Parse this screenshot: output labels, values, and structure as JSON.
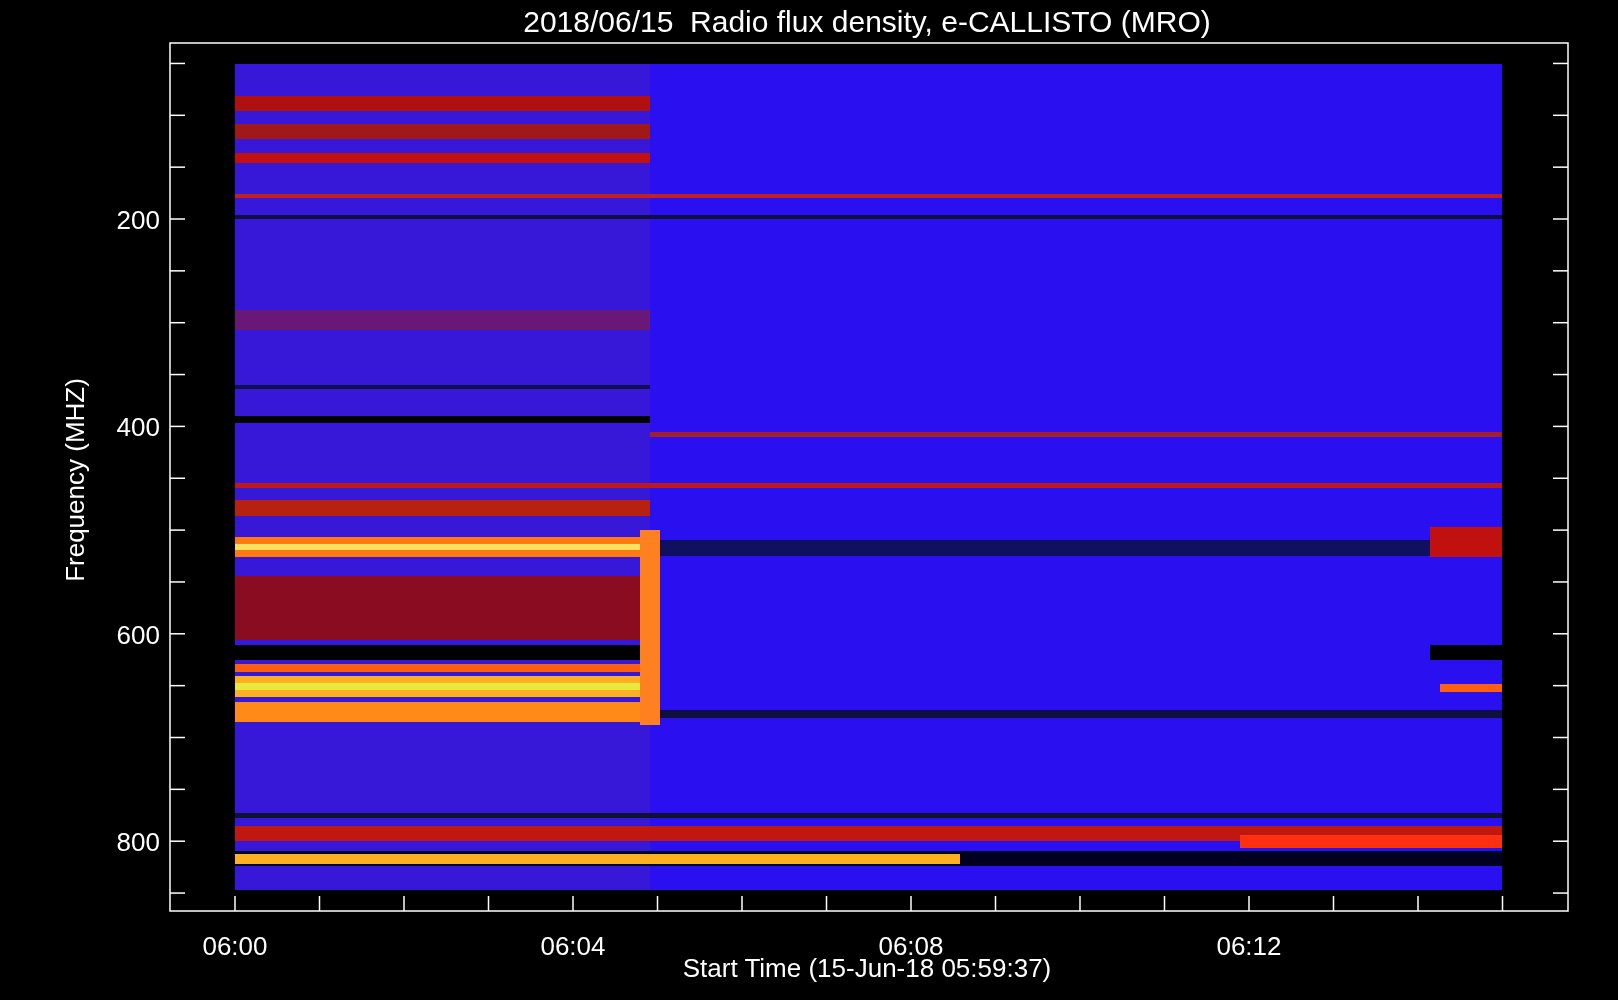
{
  "title": "2018/06/15  Radio flux density, e-CALLISTO (MRO)",
  "y_axis": {
    "label": "Frequency (MHZ)",
    "ticks": [
      "200",
      "400",
      "600",
      "800"
    ]
  },
  "x_axis": {
    "label": "Start Time (15-Jun-18 05:59:37)",
    "ticks": [
      "06:00",
      "06:04",
      "06:08",
      "06:12"
    ]
  }
}
